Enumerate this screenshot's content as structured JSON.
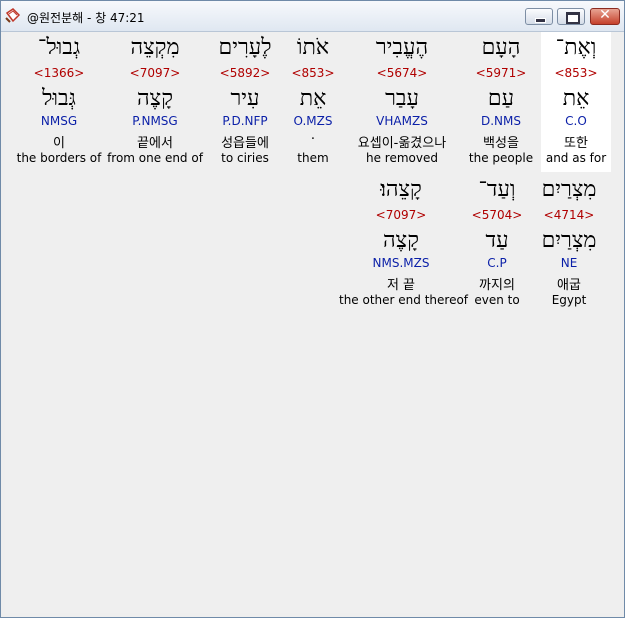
{
  "window": {
    "title": "@원전분해 - 창 47:21",
    "close_glyph": "✕"
  },
  "words": [
    {
      "id": "w1",
      "hebrew": "וְאֶת־",
      "strong": "<853>",
      "root": "אֵת",
      "parse": "C.O",
      "korean": "또한",
      "english": "and as for",
      "selected": true
    },
    {
      "id": "w2",
      "hebrew": "הָעָם",
      "strong": "<5971>",
      "root": "עַם",
      "parse": "D.NMS",
      "korean": "백성을",
      "english": "the people"
    },
    {
      "id": "w3",
      "hebrew": "הֶעֱבִיר",
      "strong": "<5674>",
      "root": "עָבַר",
      "parse": "VHAMZS",
      "korean": "요셉이-옮겼으나",
      "english": "he removed"
    },
    {
      "id": "w4",
      "hebrew": "אֹתוֹ",
      "strong": "<853>",
      "root": "אֵת",
      "parse": "O.MZS",
      "korean": ".",
      "english": "them"
    },
    {
      "id": "w5",
      "hebrew": "לֶעָרִים",
      "strong": "<5892>",
      "root": "עִיר",
      "parse": "P.D.NFP",
      "korean": "성읍들에",
      "english": "to ciries"
    },
    {
      "id": "w6",
      "hebrew": "מִקְצֵה",
      "strong": "<7097>",
      "root": "קָצֶה",
      "parse": "P.NMSG",
      "korean": "끝에서",
      "english": "from one end of"
    },
    {
      "id": "w7",
      "hebrew": "גְבוּל־",
      "strong": "<1366>",
      "root": "גְּבוּל",
      "parse": "NMSG",
      "korean": "이",
      "english": "the borders of"
    },
    {
      "id": "w8",
      "hebrew": "מִצְרַיִם",
      "strong": "<4714>",
      "root": "מִצְרַיִם",
      "parse": "NE",
      "korean": "애굽",
      "english": "Egypt"
    },
    {
      "id": "w9",
      "hebrew": "וְעַד־",
      "strong": "<5704>",
      "root": "עַד",
      "parse": "C.P",
      "korean": "까지의",
      "english": "even to"
    },
    {
      "id": "w10",
      "hebrew": "קָצֵהוּ׃",
      "strong": "<7097>",
      "root": "קָצֶה",
      "parse": "NMS.MZS",
      "korean": "저 끝",
      "english": "the other end thereof"
    }
  ]
}
